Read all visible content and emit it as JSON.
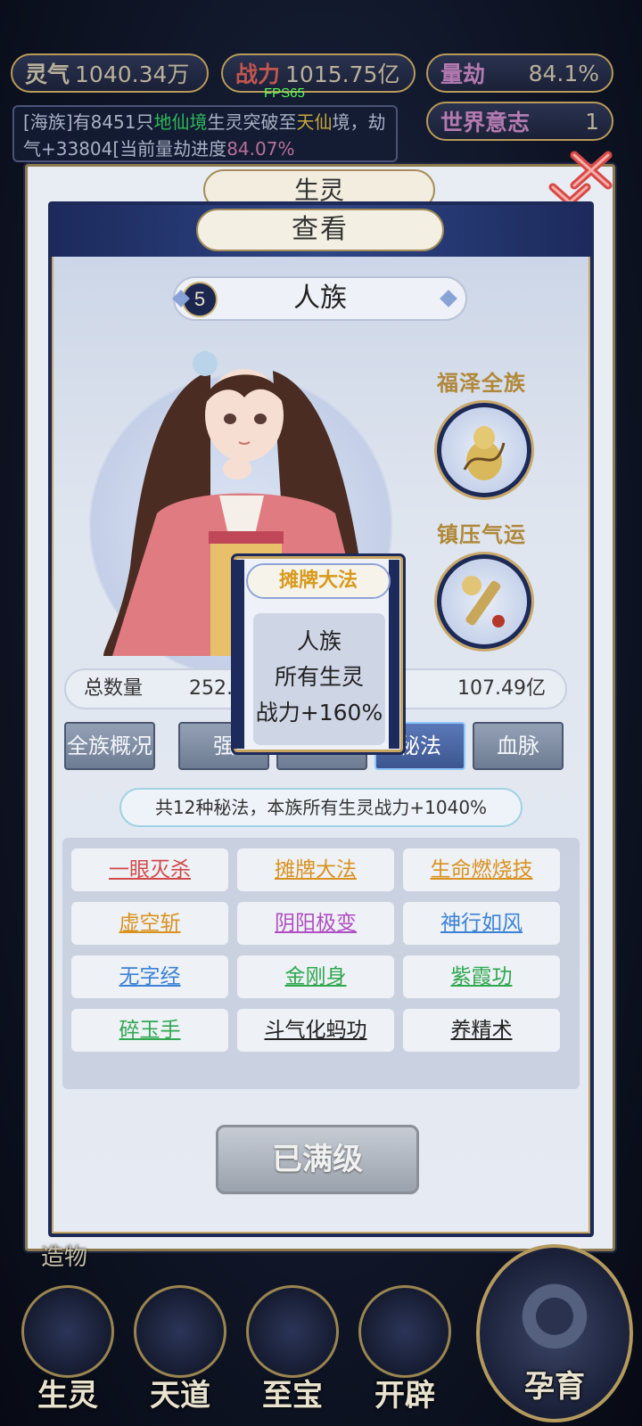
{
  "hud": {
    "lingqi": {
      "label": "灵气",
      "value": "1040.34万"
    },
    "zhanli": {
      "label": "战力",
      "value": "1015.75亿"
    },
    "liangjie": {
      "label": "量劫",
      "value": "84.1%"
    },
    "shijie": {
      "label": "世界意志",
      "value": "1"
    },
    "fps": "FPS65"
  },
  "notice": {
    "part1": "[海族]有8451只",
    "realm": "地仙境",
    "part2": "生灵突破至",
    "realm2": "天仙",
    "part3": "境，劫气+33804[当前量劫进度",
    "progress": "84.07%"
  },
  "back_panel": {
    "title": "生灵"
  },
  "panel": {
    "title": "查看"
  },
  "race": {
    "level": "5",
    "name": "人族"
  },
  "buffs": [
    {
      "label": "福泽全族",
      "icon": "gourd-icon"
    },
    {
      "label": "镇压气运",
      "icon": "mace-icon"
    }
  ],
  "totals": {
    "label": "总数量",
    "count": "252.",
    "power": "107.49亿"
  },
  "tabs": [
    "全族概况",
    "强",
    "",
    "秘法",
    "血脉"
  ],
  "summary": "共12种秘法，本族所有生灵战力+1040%",
  "skills": [
    {
      "name": "一眼灭杀",
      "color": "#d14b4b"
    },
    {
      "name": "摊牌大法",
      "color": "#d9921f"
    },
    {
      "name": "生命燃烧技",
      "color": "#d9921f"
    },
    {
      "name": "虚空斩",
      "color": "#d9921f"
    },
    {
      "name": "阴阳极变",
      "color": "#b04fc2"
    },
    {
      "name": "神行如风",
      "color": "#3b82d6"
    },
    {
      "name": "无字经",
      "color": "#3b82d6"
    },
    {
      "name": "金刚身",
      "color": "#2fa84f"
    },
    {
      "name": "紫霞功",
      "color": "#2fa84f"
    },
    {
      "name": "碎玉手",
      "color": "#2fa84f"
    },
    {
      "name": "斗气化蚂功",
      "color": "#222222"
    },
    {
      "name": "养精术",
      "color": "#222222"
    }
  ],
  "max_button": "已满级",
  "tooltip": {
    "title": "摊牌大法",
    "line1": "人族",
    "line2": "所有生灵",
    "line3": "战力+160%"
  },
  "bottom_nav": {
    "create": "造物",
    "items": [
      "生灵",
      "天道",
      "至宝",
      "开辟"
    ],
    "big": "孕育"
  }
}
